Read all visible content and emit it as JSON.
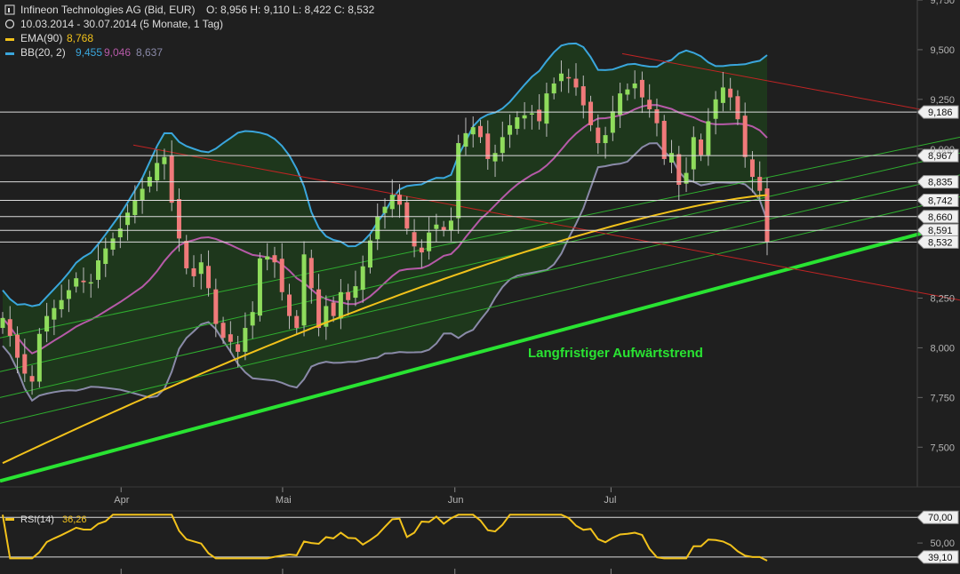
{
  "header": {
    "title": "Infineon Technologies AG (Bid, EUR)",
    "ohlc": "O: 8,956  H: 9,110  L: 8,422  C: 8,532",
    "period": "10.03.2014 - 30.07.2014 (5 Monate, 1 Tag)",
    "ema_label": "EMA(90)",
    "ema_value": "8,768",
    "bb_label": "BB(20, 2)",
    "bb_upper": "9,455",
    "bb_middle": "9,046",
    "bb_lower": "8,637",
    "rsi_label": "RSI(14)",
    "rsi_value": "36,26"
  },
  "annotation": "Langfristiger Aufwärtstrend",
  "colors": {
    "background": "#1f1f1f",
    "up": "#8fdc5c",
    "down": "#f07a7a",
    "ema": "#f2c21b",
    "bb_upper": "#3aa6dc",
    "bb_middle": "#b65aa8",
    "bb_lower": "#8a8aa8",
    "trend_main": "#29e332",
    "trend_thin": "#2fae2f",
    "resistance": "#c22424",
    "rsi": "#f2c21b"
  },
  "chart_data": [
    {
      "type": "candlestick",
      "title": "Infineon Technologies AG (Bid, EUR)",
      "x_range": [
        "2014-03-10",
        "2014-07-30"
      ],
      "x_ticks": [
        {
          "date": "2014-04-01",
          "label": "Apr"
        },
        {
          "date": "2014-05-01",
          "label": "Mai"
        },
        {
          "date": "2014-06-02",
          "label": "Jun"
        },
        {
          "date": "2014-07-01",
          "label": "Jul"
        }
      ],
      "ylim": [
        7.3,
        9.75
      ],
      "y_ticks": [
        "7,500",
        "7,750",
        "8,000",
        "8,250",
        "9,000",
        "9,250",
        "9,500",
        "9,750"
      ],
      "horizontal_levels": [
        {
          "value": 9.186,
          "label": "9,186"
        },
        {
          "value": 8.967,
          "label": "8,967"
        },
        {
          "value": 8.835,
          "label": "8,835"
        },
        {
          "value": 8.742,
          "label": "8,742"
        },
        {
          "value": 8.66,
          "label": "8,660"
        },
        {
          "value": 8.591,
          "label": "8,591"
        },
        {
          "value": 8.532,
          "label": "8,532"
        }
      ],
      "closes": [
        8.15,
        8.06,
        7.95,
        7.87,
        7.83,
        8.07,
        8.16,
        8.2,
        8.24,
        8.29,
        8.35,
        8.33,
        8.33,
        8.44,
        8.5,
        8.55,
        8.6,
        8.68,
        8.74,
        8.8,
        8.86,
        8.93,
        8.96,
        8.73,
        8.55,
        8.4,
        8.36,
        8.43,
        8.3,
        8.12,
        8.05,
        8.03,
        7.98,
        8.1,
        8.18,
        8.45,
        8.46,
        8.43,
        8.28,
        8.16,
        8.1,
        8.47,
        8.3,
        8.1,
        8.21,
        8.16,
        8.28,
        8.24,
        8.31,
        8.41,
        8.54,
        8.66,
        8.71,
        8.77,
        8.72,
        8.6,
        8.51,
        8.48,
        8.58,
        8.62,
        8.59,
        8.64,
        9.03,
        9.08,
        9.11,
        9.06,
        8.95,
        8.98,
        9.06,
        9.12,
        9.16,
        9.17,
        9.18,
        9.14,
        9.28,
        9.33,
        9.38,
        9.36,
        9.31,
        9.22,
        9.12,
        9.03,
        9.07,
        9.19,
        9.28,
        9.3,
        9.33,
        9.26,
        9.2,
        9.13,
        8.95,
        8.98,
        8.82,
        8.88,
        9.06,
        8.97,
        9.14,
        9.25,
        9.31,
        9.26,
        9.15,
        8.96,
        8.86,
        8.79,
        8.532
      ],
      "ema90_end": 8.768,
      "rsi": {
        "label": "RSI(14)",
        "last": 36.26,
        "levels": [
          {
            "value": 70,
            "label": "70,00"
          },
          {
            "value": 50,
            "label": "50,00"
          },
          {
            "value": 39.1,
            "label": "39,10"
          }
        ]
      }
    }
  ]
}
